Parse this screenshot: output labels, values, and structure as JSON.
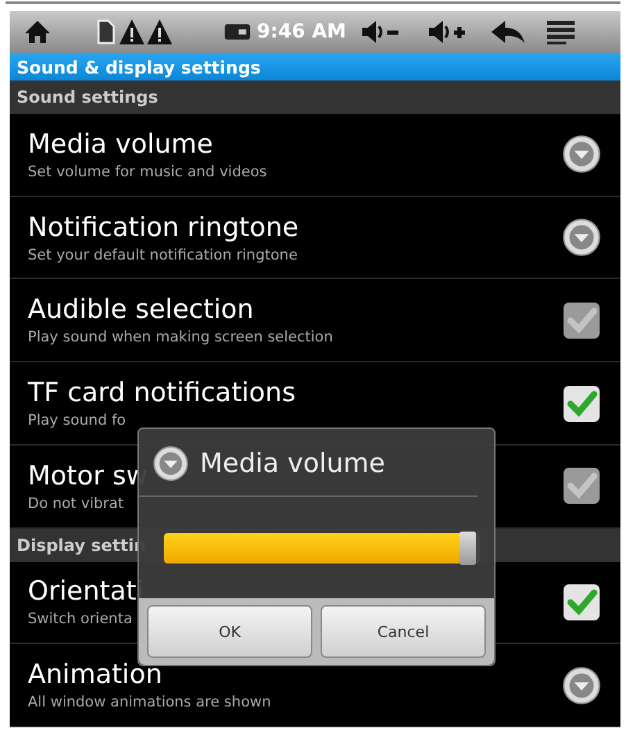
{
  "status_bar": {
    "time": "9:46 AM"
  },
  "title_bar": {
    "title": "Sound & display settings"
  },
  "items": [
    {
      "kind": "header",
      "title": "Sound settings"
    },
    {
      "kind": "dropdown",
      "title": "Media volume",
      "summary": "Set volume for music and videos"
    },
    {
      "kind": "dropdown",
      "title": "Notification ringtone",
      "summary": "Set your default notification ringtone"
    },
    {
      "kind": "checkbox",
      "title": "Audible selection",
      "summary": "Play sound when making screen selection",
      "checked": false
    },
    {
      "kind": "checkbox",
      "title": "TF card notifications",
      "summary": "Play sound fo",
      "checked": true
    },
    {
      "kind": "checkbox",
      "title": "Motor sw",
      "summary": "Do not vibrat",
      "checked": false
    },
    {
      "kind": "header",
      "title": "Display settin"
    },
    {
      "kind": "checkbox",
      "title": "Orientati",
      "summary": "Switch orienta",
      "checked": true
    },
    {
      "kind": "dropdown",
      "title": "Animation",
      "summary": "All window animations are shown"
    }
  ],
  "dialog": {
    "title": "Media volume",
    "slider": {
      "level": 0.96
    },
    "buttons": [
      "OK",
      "Cancel"
    ]
  }
}
